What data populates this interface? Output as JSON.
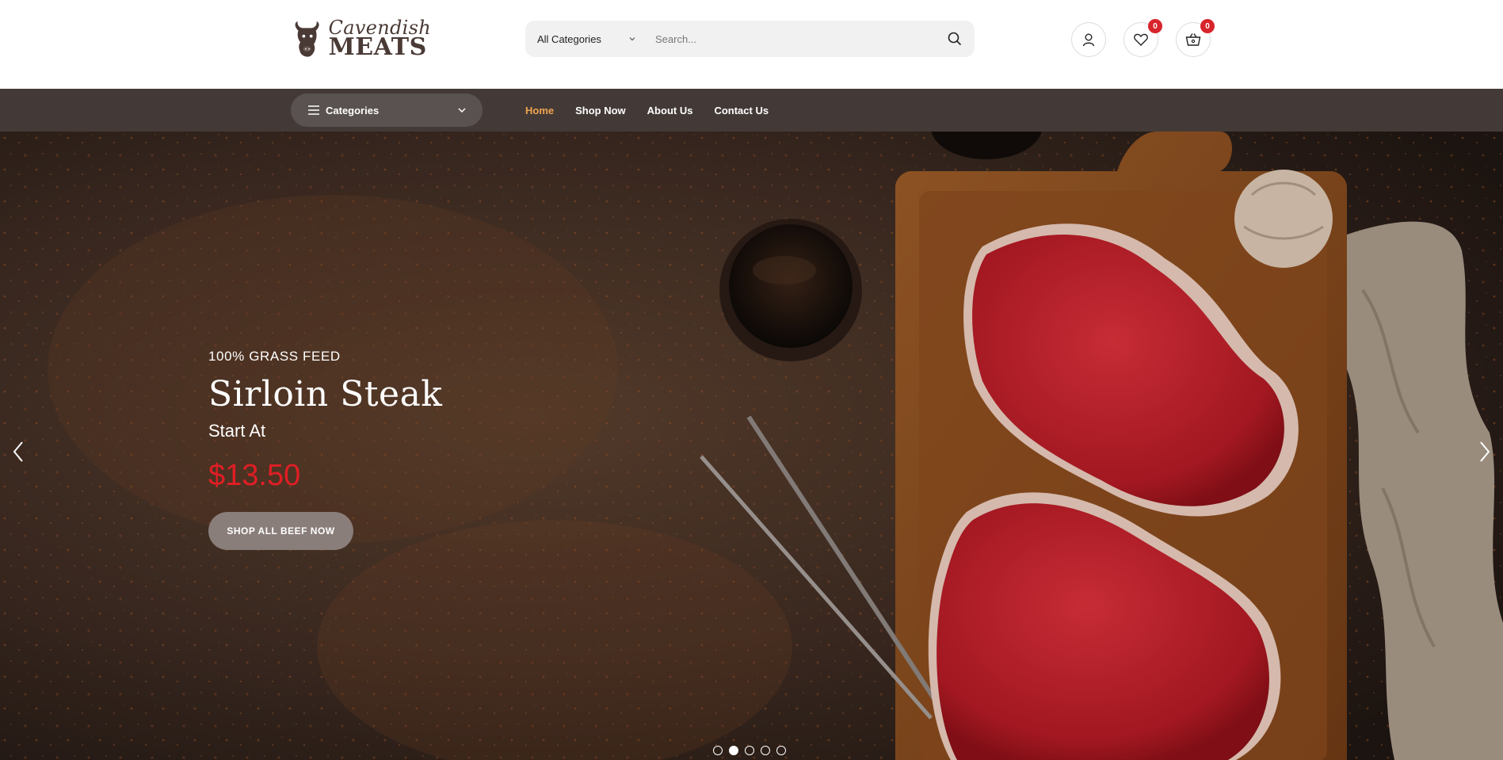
{
  "brand": {
    "logo_script": "Cavendish",
    "logo_block": "MEATS"
  },
  "search": {
    "category_label": "All Categories",
    "placeholder": "Search..."
  },
  "header_actions": {
    "wishlist_count": "0",
    "cart_count": "0"
  },
  "nav": {
    "categories_label": "Categories",
    "links": [
      {
        "label": "Home",
        "active": true
      },
      {
        "label": "Shop Now",
        "active": false
      },
      {
        "label": "About Us",
        "active": false
      },
      {
        "label": "Contact Us",
        "active": false
      }
    ]
  },
  "hero": {
    "eyebrow": "100% GRASS FEED",
    "headline": "Sirloin Steak",
    "subline": "Start At",
    "price": "$13.50",
    "cta": "SHOP ALL BEEF NOW",
    "slide_count": 5,
    "active_slide": 2
  },
  "colors": {
    "nav_bg": "#433a37",
    "active_link": "#f0a451",
    "price": "#e01e25",
    "badge": "#d8242c"
  }
}
